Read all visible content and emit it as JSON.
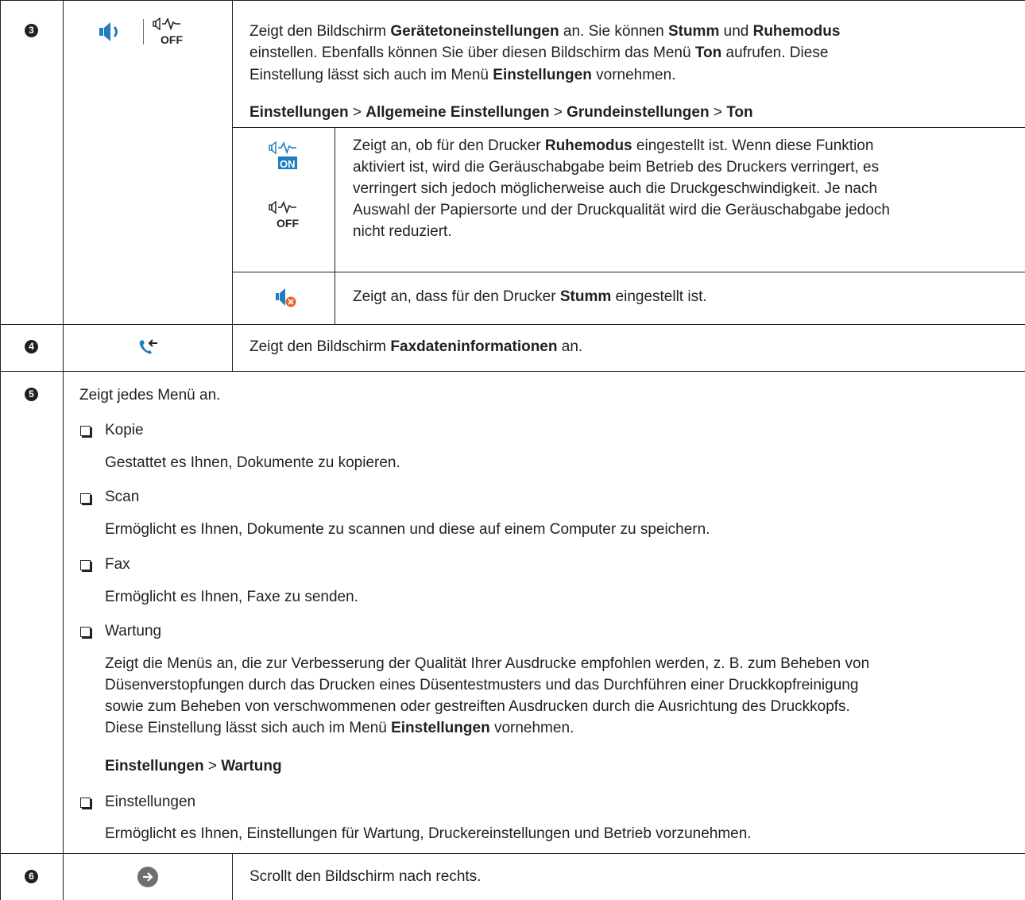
{
  "rows": [
    {
      "number": "3",
      "desc_line1": [
        "Zeigt den Bildschirm ",
        "Gerätetoneinstellungen",
        " an. Sie können ",
        "Stumm",
        " und ",
        "Ruhemodus"
      ],
      "desc_line2": "einstellen. Ebenfalls können Sie über diesen Bildschirm das Menü ",
      "desc_line2_bold": "Ton",
      "desc_line2_end": " aufrufen. Diese",
      "desc_line3": "Einstellung lässt sich auch im Menü ",
      "desc_line3_bold": "Einstellungen",
      "desc_line3_end": " vornehmen.",
      "path": [
        "Einstellungen",
        "Allgemeine Einstellungen",
        "Grundeinstellungen",
        "Ton"
      ],
      "path_sep": " > ",
      "sub_quiet": {
        "line1": "Zeigt an, ob für den Drucker ",
        "line1_bold": "Ruhemodus",
        "line1_end": " eingestellt ist. Wenn diese Funktion",
        "line2": "aktiviert ist, wird die Geräuschabgabe beim Betrieb des Druckers verringert, es",
        "line3": "verringert sich jedoch möglicherweise auch die Druckgeschwindigkeit. Je nach",
        "line4": "Auswahl der Papiersorte und der Druckqualität wird die Geräuschabgabe jedoch",
        "line5": "nicht reduziert.",
        "icon_on_text": "ON",
        "icon_off_text": "OFF"
      },
      "sub_mute": {
        "text": "Zeigt an, dass für den Drucker ",
        "bold": "Stumm",
        "end": " eingestellt ist."
      },
      "icon_off_text": "OFF"
    },
    {
      "number": "4",
      "text": "Zeigt den Bildschirm ",
      "bold": "Faxdateninformationen",
      "end": " an."
    },
    {
      "number": "5",
      "intro": "Zeigt jedes Menü an.",
      "items": [
        {
          "label": "Kopie",
          "desc": [
            "Gestattet es Ihnen, Dokumente zu kopieren."
          ]
        },
        {
          "label": "Scan",
          "desc": [
            "Ermöglicht es Ihnen, Dokumente zu scannen und diese auf einem Computer zu speichern."
          ]
        },
        {
          "label": "Fax",
          "desc": [
            "Ermöglicht es Ihnen, Faxe zu senden."
          ]
        },
        {
          "label": "Wartung",
          "desc": [
            "Zeigt die Menüs an, die zur Verbesserung der Qualität Ihrer Ausdrucke empfohlen werden, z. B. zum Beheben von",
            "Düsenverstopfungen durch das Drucken eines Düsentestmusters und das Durchführen einer Druckkopfreinigung",
            "sowie zum Beheben von verschwommenen oder gestreiften Ausdrucken durch die Ausrichtung des Druckkopfs."
          ]
        },
        {
          "label": "Einstellungen",
          "desc": [
            "Ermöglicht es Ihnen, Einstellungen für Wartung, Druckereinstellungen und Betrieb vorzunehmen."
          ]
        }
      ],
      "wartung_last": "Diese Einstellung lässt sich auch im Menü ",
      "wartung_last_bold": "Einstellungen",
      "wartung_last_end": " vornehmen.",
      "wartung_path": [
        "Einstellungen",
        "Wartung"
      ],
      "path_sep": " > "
    },
    {
      "number": "6",
      "text": "Scrollt den Bildschirm nach rechts."
    }
  ],
  "colors": {
    "ink": "#231f20",
    "icon_blue": "#1f7ec1",
    "icon_orange": "#e8632b",
    "arrow_grey": "#6d6e71"
  }
}
